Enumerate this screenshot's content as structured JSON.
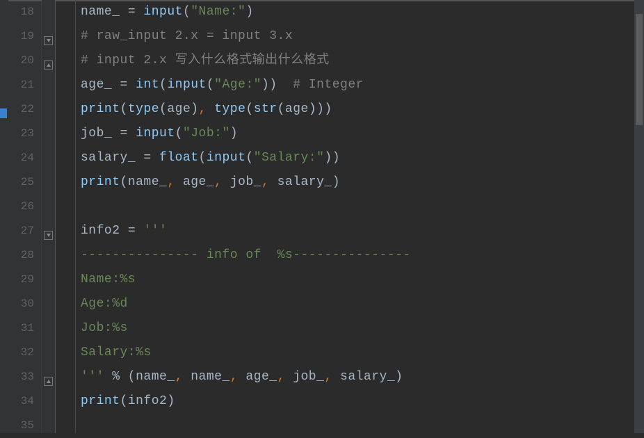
{
  "lines": [
    {
      "num": "18",
      "fold": null,
      "tokens": [
        {
          "t": "name_ ",
          "c": "tok-default"
        },
        {
          "t": "= ",
          "c": "tok-operator"
        },
        {
          "t": "input",
          "c": "tok-builtin"
        },
        {
          "t": "(",
          "c": "tok-default"
        },
        {
          "t": "\"Name:\"",
          "c": "tok-string"
        },
        {
          "t": ")",
          "c": "tok-default"
        }
      ]
    },
    {
      "num": "19",
      "fold": "down",
      "tokens": [
        {
          "t": "# raw_input 2.x = input 3.x",
          "c": "tok-comment"
        }
      ]
    },
    {
      "num": "20",
      "fold": "up",
      "tokens": [
        {
          "t": "# input 2.x 写入什么格式输出什么格式",
          "c": "tok-comment"
        }
      ]
    },
    {
      "num": "21",
      "fold": null,
      "tokens": [
        {
          "t": "age_ ",
          "c": "tok-default"
        },
        {
          "t": "= ",
          "c": "tok-operator"
        },
        {
          "t": "int",
          "c": "tok-builtin"
        },
        {
          "t": "(",
          "c": "tok-default"
        },
        {
          "t": "input",
          "c": "tok-builtin"
        },
        {
          "t": "(",
          "c": "tok-default"
        },
        {
          "t": "\"Age:\"",
          "c": "tok-string"
        },
        {
          "t": "))  ",
          "c": "tok-default"
        },
        {
          "t": "# Integer",
          "c": "tok-comment"
        }
      ]
    },
    {
      "num": "22",
      "fold": null,
      "tokens": [
        {
          "t": "print",
          "c": "tok-builtin"
        },
        {
          "t": "(",
          "c": "tok-default"
        },
        {
          "t": "type",
          "c": "tok-builtin"
        },
        {
          "t": "(age)",
          "c": "tok-default"
        },
        {
          "t": ", ",
          "c": "tok-comma"
        },
        {
          "t": "type",
          "c": "tok-builtin"
        },
        {
          "t": "(",
          "c": "tok-default"
        },
        {
          "t": "str",
          "c": "tok-builtin"
        },
        {
          "t": "(age)))",
          "c": "tok-default"
        }
      ]
    },
    {
      "num": "23",
      "fold": null,
      "tokens": [
        {
          "t": "job_ ",
          "c": "tok-default"
        },
        {
          "t": "= ",
          "c": "tok-operator"
        },
        {
          "t": "input",
          "c": "tok-builtin"
        },
        {
          "t": "(",
          "c": "tok-default"
        },
        {
          "t": "\"Job:\"",
          "c": "tok-string"
        },
        {
          "t": ")",
          "c": "tok-default"
        }
      ]
    },
    {
      "num": "24",
      "fold": null,
      "tokens": [
        {
          "t": "salary_ ",
          "c": "tok-default"
        },
        {
          "t": "= ",
          "c": "tok-operator"
        },
        {
          "t": "float",
          "c": "tok-builtin"
        },
        {
          "t": "(",
          "c": "tok-default"
        },
        {
          "t": "input",
          "c": "tok-builtin"
        },
        {
          "t": "(",
          "c": "tok-default"
        },
        {
          "t": "\"Salary:\"",
          "c": "tok-string"
        },
        {
          "t": "))",
          "c": "tok-default"
        }
      ]
    },
    {
      "num": "25",
      "fold": null,
      "tokens": [
        {
          "t": "print",
          "c": "tok-builtin"
        },
        {
          "t": "(name_",
          "c": "tok-default"
        },
        {
          "t": ", ",
          "c": "tok-comma"
        },
        {
          "t": "age_",
          "c": "tok-default"
        },
        {
          "t": ", ",
          "c": "tok-comma"
        },
        {
          "t": "job_",
          "c": "tok-default"
        },
        {
          "t": ", ",
          "c": "tok-comma"
        },
        {
          "t": "salary_)",
          "c": "tok-default"
        }
      ]
    },
    {
      "num": "26",
      "fold": null,
      "tokens": []
    },
    {
      "num": "27",
      "fold": "down",
      "tokens": [
        {
          "t": "info2 ",
          "c": "tok-default"
        },
        {
          "t": "= ",
          "c": "tok-operator"
        },
        {
          "t": "'''",
          "c": "tok-string"
        }
      ]
    },
    {
      "num": "28",
      "fold": null,
      "tokens": [
        {
          "t": "--------------- info of  %s---------------",
          "c": "tok-string"
        }
      ]
    },
    {
      "num": "29",
      "fold": null,
      "tokens": [
        {
          "t": "Name:%s",
          "c": "tok-string"
        }
      ]
    },
    {
      "num": "30",
      "fold": null,
      "tokens": [
        {
          "t": "Age:%d",
          "c": "tok-string"
        }
      ]
    },
    {
      "num": "31",
      "fold": null,
      "tokens": [
        {
          "t": "Job:%s",
          "c": "tok-string"
        }
      ]
    },
    {
      "num": "32",
      "fold": null,
      "tokens": [
        {
          "t": "Salary:%s",
          "c": "tok-string"
        }
      ]
    },
    {
      "num": "33",
      "fold": "up",
      "tokens": [
        {
          "t": "'''",
          "c": "tok-string"
        },
        {
          "t": " % (name_",
          "c": "tok-default"
        },
        {
          "t": ", ",
          "c": "tok-comma"
        },
        {
          "t": "name_",
          "c": "tok-default"
        },
        {
          "t": ", ",
          "c": "tok-comma"
        },
        {
          "t": "age_",
          "c": "tok-default"
        },
        {
          "t": ", ",
          "c": "tok-comma"
        },
        {
          "t": "job_",
          "c": "tok-default"
        },
        {
          "t": ", ",
          "c": "tok-comma"
        },
        {
          "t": "salary_)",
          "c": "tok-default"
        }
      ]
    },
    {
      "num": "34",
      "fold": null,
      "tokens": [
        {
          "t": "print",
          "c": "tok-builtin"
        },
        {
          "t": "(info2)",
          "c": "tok-default"
        }
      ]
    },
    {
      "num": "35",
      "fold": null,
      "tokens": []
    }
  ],
  "marker_line_index": 4
}
